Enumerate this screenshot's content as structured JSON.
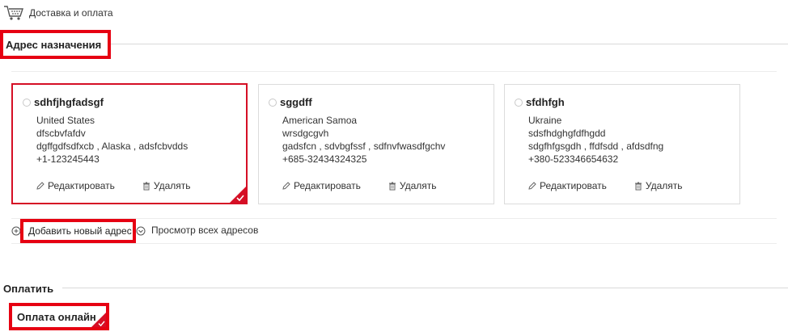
{
  "breadcrumb": {
    "label": "Доставка и оплата",
    "icon": "cart-icon"
  },
  "address_section": {
    "title": "Адрес назначения"
  },
  "addresses": [
    {
      "name": "sdhfjhgfadsgf",
      "country": "United States",
      "street": "dfscbvfafdv",
      "city_line": "dgffgdfsdfxcb , Alaska , adsfcbvdds",
      "phone": "+1-123245443",
      "edit_label": "Редактировать",
      "delete_label": "Удалять",
      "selected": true
    },
    {
      "name": "sggdff",
      "country": "American Samoa",
      "street": "wrsdgcgvh",
      "city_line": "gadsfcn , sdvbgfssf , sdfnvfwasdfgchv",
      "phone": "+685-32434324325",
      "edit_label": "Редактировать",
      "delete_label": "Удалять",
      "selected": false
    },
    {
      "name": "sfdhfgh",
      "country": "Ukraine",
      "street": "sdsfhdghgfdfhgdd",
      "city_line": "sdgfhfgsgdh , ffdfsdd , afdsdfng",
      "phone": "+380-523346654632",
      "edit_label": "Редактировать",
      "delete_label": "Удалять",
      "selected": false
    }
  ],
  "links": {
    "add_new": "Добавить новый адрес",
    "view_all": "Просмотр всех адресов"
  },
  "payment_section": {
    "title": "Оплатить",
    "option": "Оплата онлайн",
    "option_selected": true
  },
  "colors": {
    "accent_red": "#e60012",
    "selected_border": "#d50f25",
    "text": "#333333",
    "divider": "#d9d9d9"
  }
}
